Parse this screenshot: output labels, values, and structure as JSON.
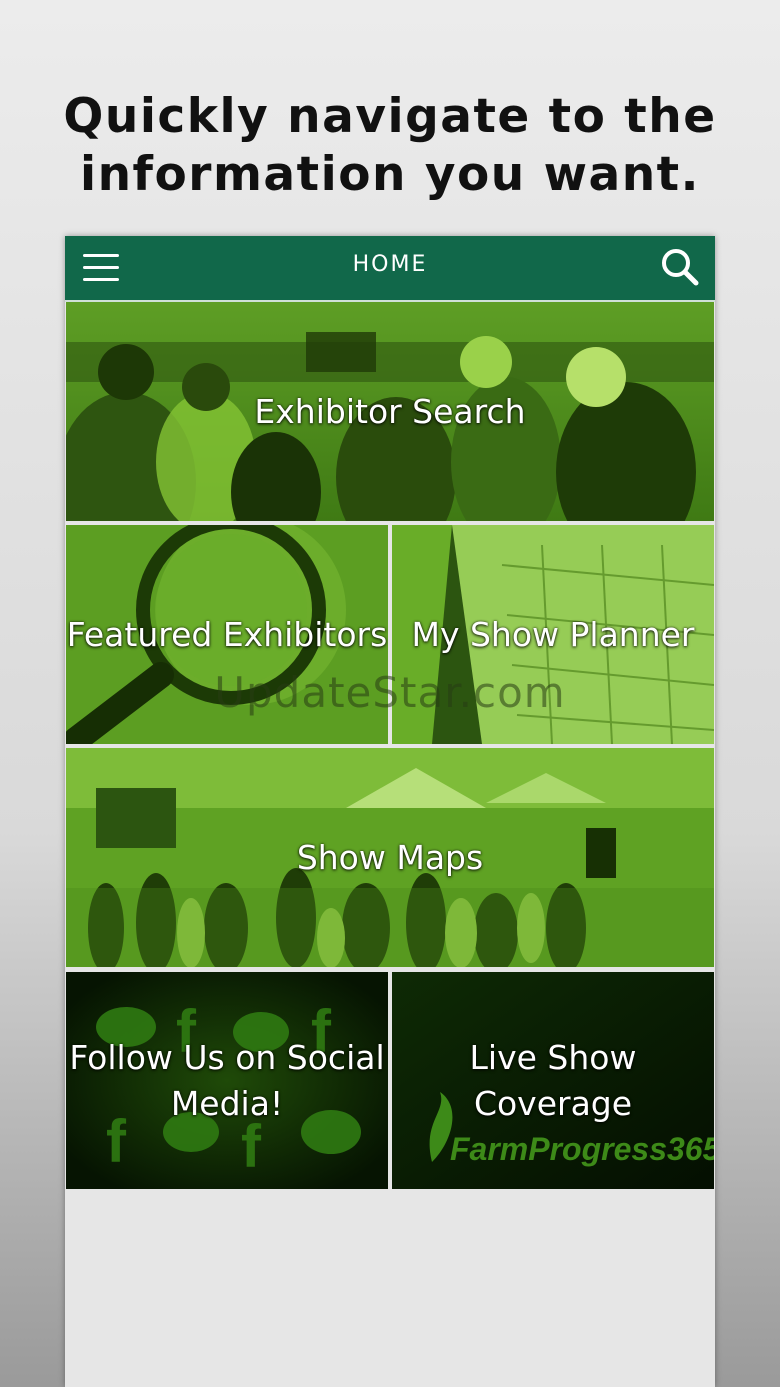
{
  "headline": {
    "line1": "Quickly navigate to the",
    "line2": "information you want."
  },
  "navbar": {
    "title": "HOME",
    "menu_icon": "hamburger-menu-icon",
    "search_icon": "search-icon",
    "background": "#11684a"
  },
  "tiles": {
    "exhibitor_search": "Exhibitor Search",
    "featured_exhibitors": "Featured Exhibitors",
    "my_show_planner": "My Show Planner",
    "show_maps": "Show Maps",
    "social_line1": "Follow Us on Social",
    "social_line2": "Media!",
    "live_line1": "Live Show",
    "live_line2": "Coverage",
    "live_logo": "FarmProgress365"
  },
  "watermark": "UpdateStar.com",
  "colors": {
    "tile_green": "#6fb52a",
    "tile_dark": "#0e2a05"
  }
}
